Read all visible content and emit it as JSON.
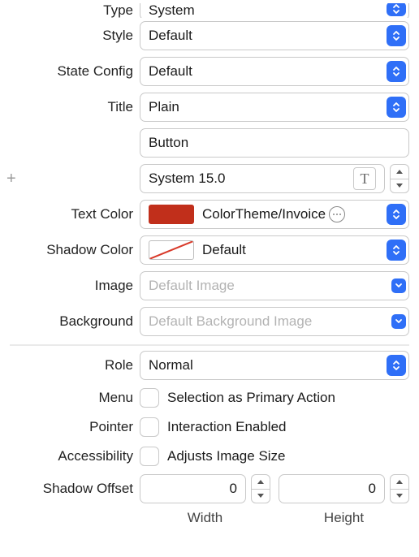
{
  "type": {
    "label": "Type",
    "value": "System"
  },
  "style": {
    "label": "Style",
    "value": "Default"
  },
  "stateConfig": {
    "label": "State Config",
    "value": "Default"
  },
  "title": {
    "label": "Title",
    "value": "Plain"
  },
  "titleText": "Button",
  "font": "System 15.0",
  "textColor": {
    "label": "Text Color",
    "value": "ColorTheme/Invoice"
  },
  "shadowColor": {
    "label": "Shadow Color",
    "value": "Default"
  },
  "image": {
    "label": "Image",
    "placeholder": "Default Image"
  },
  "background": {
    "label": "Background",
    "placeholder": "Default Background Image"
  },
  "role": {
    "label": "Role",
    "value": "Normal"
  },
  "menu": {
    "label": "Menu",
    "option": "Selection as Primary Action"
  },
  "pointer": {
    "label": "Pointer",
    "option": "Interaction Enabled"
  },
  "accessibility": {
    "label": "Accessibility",
    "option": "Adjusts Image Size"
  },
  "shadowOffset": {
    "label": "Shadow Offset",
    "width": "0",
    "height": "0",
    "widthLabel": "Width",
    "heightLabel": "Height"
  }
}
